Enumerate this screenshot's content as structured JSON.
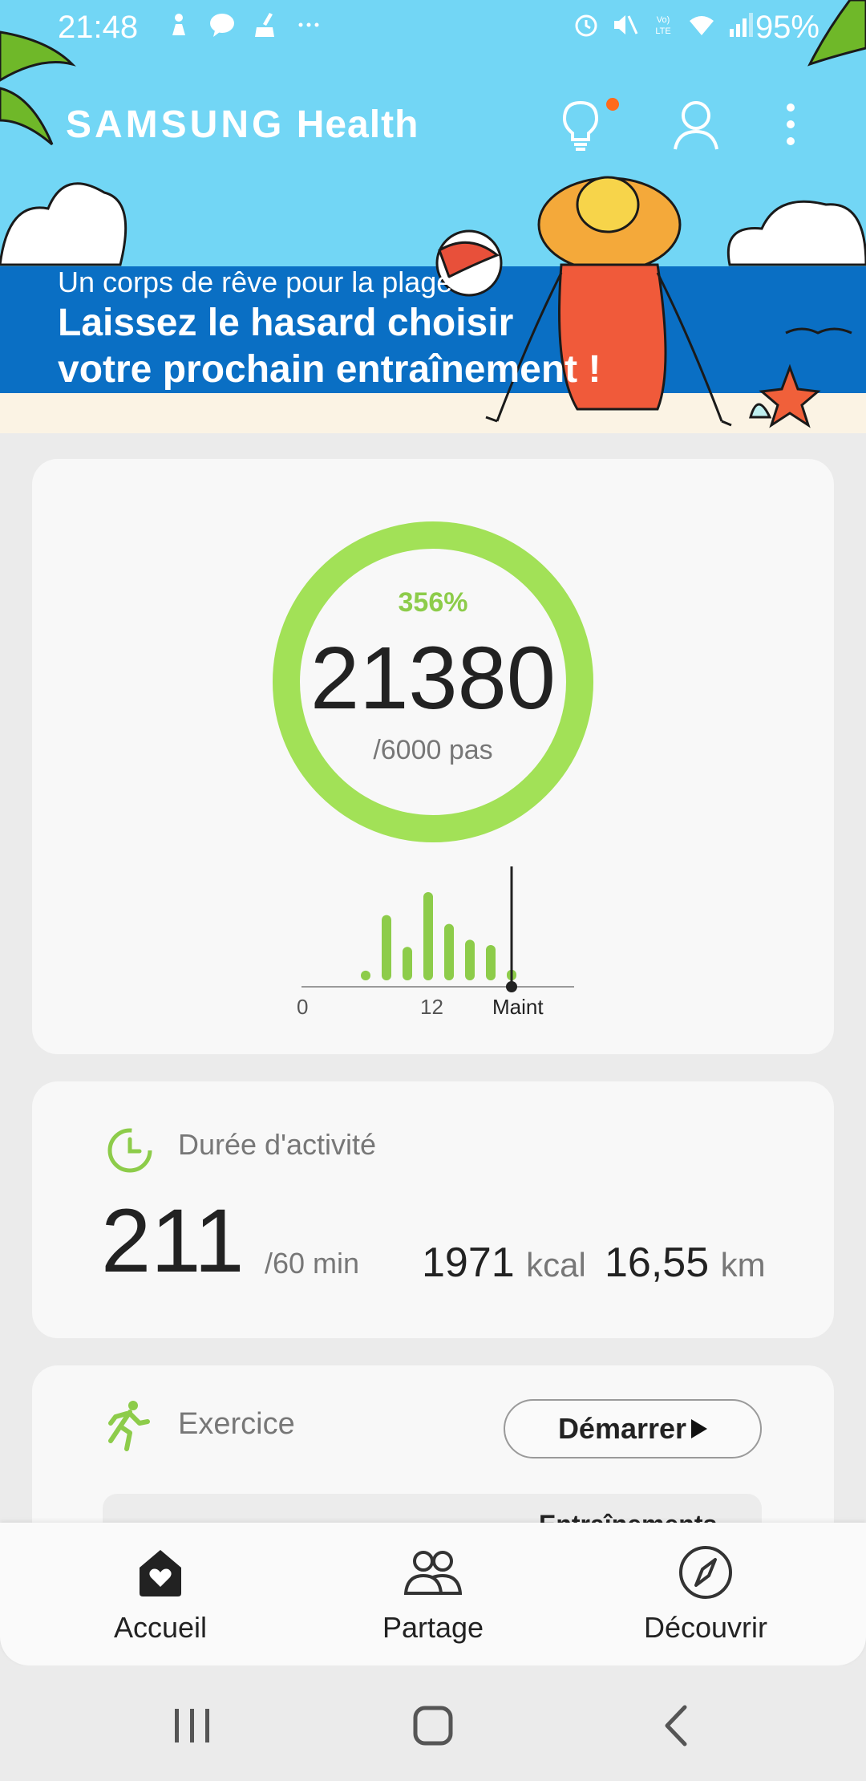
{
  "status_bar": {
    "time": "21:48",
    "left_icons": [
      "child-icon",
      "chat-bubble-icon",
      "cleaner-icon",
      "more-dots-icon"
    ],
    "right_icons": [
      "alarm-icon",
      "mute-icon",
      "volte-icon",
      "wifi-icon",
      "signal-icon"
    ],
    "battery": "95%"
  },
  "header": {
    "brand_part1": "SAMSUNG",
    "brand_part2": "Health",
    "notification_dot_color": "#ff6a1a"
  },
  "banner": {
    "subtitle": "Un corps de rêve pour la plage :",
    "title_line1": "Laissez le hasard choisir",
    "title_line2": "votre prochain entraînement !"
  },
  "steps": {
    "percent": "356%",
    "value": "21380",
    "goal": "/6000 pas",
    "progress_fraction": 1.0,
    "ring_color": "#a2e157",
    "chart_labels": [
      "0",
      "12",
      "Maint"
    ],
    "bars": [
      0.11,
      0.74,
      0.38,
      1.0,
      0.64,
      0.46,
      0.4,
      0.12
    ]
  },
  "activity": {
    "title": "Durée d'activité",
    "value": "211",
    "goal": "/60 min",
    "kcal_value": "1971",
    "kcal_unit": "kcal",
    "distance_value": "16,55",
    "distance_unit": "km"
  },
  "exercise": {
    "title": "Exercice",
    "start_label": "Démarrer",
    "strip_label": "Entraînements"
  },
  "bottom_nav": {
    "items": [
      {
        "label": "Accueil",
        "icon": "home-heart-icon"
      },
      {
        "label": "Partage",
        "icon": "people-icon"
      },
      {
        "label": "Découvrir",
        "icon": "compass-icon"
      }
    ]
  },
  "accent_color": "#8dcc4a"
}
